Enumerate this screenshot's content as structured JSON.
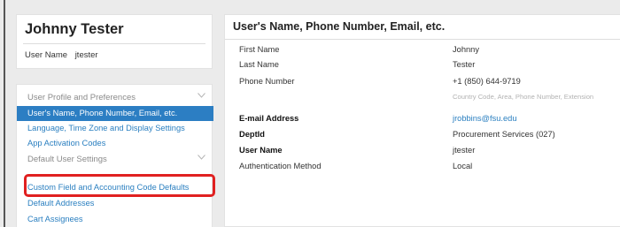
{
  "user_card": {
    "display_name": "Johnny Tester",
    "user_name_label": "User Name",
    "user_name_value": "jtester"
  },
  "menu": {
    "section1_label": "User Profile and Preferences",
    "items": [
      {
        "label": "User's Name, Phone Number, Email, etc.",
        "active": true
      },
      {
        "label": "Language, Time Zone and Display Settings"
      },
      {
        "label": "App Activation Codes"
      }
    ],
    "section2_label": "Default User Settings",
    "items2": [
      {
        "label": "Custom Field and Accounting Code Defaults"
      },
      {
        "label": "Default Addresses"
      },
      {
        "label": "Cart Assignees"
      }
    ]
  },
  "detail": {
    "title": "User's Name, Phone Number, Email, etc.",
    "fields": {
      "first_name_label": "First Name",
      "first_name_value": "Johnny",
      "last_name_label": "Last Name",
      "last_name_value": "Tester",
      "phone_label": "Phone Number",
      "phone_value": "+1 (850) 644-9719",
      "phone_hint": "Country Code, Area, Phone Number, Extension",
      "email_label": "E-mail Address",
      "email_value": "jrobbins@fsu.edu",
      "deptid_label": "DeptId",
      "deptid_value": "Procurement Services (027)",
      "username_label": "User Name",
      "username_value": "jtester",
      "auth_label": "Authentication Method",
      "auth_value": "Local"
    }
  },
  "colors": {
    "accent": "#2c7ec3",
    "link": "#2a7fc0",
    "highlight": "#e02020"
  },
  "icons": {
    "section_toggle": "chevron-down-icon"
  }
}
